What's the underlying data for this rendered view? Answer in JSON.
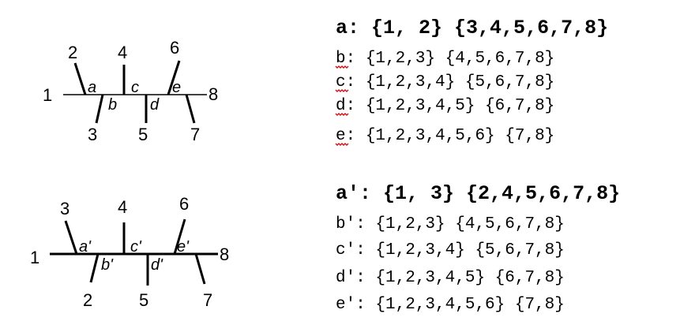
{
  "trees": [
    {
      "leaves": [
        "1",
        "2",
        "3",
        "4",
        "5",
        "6",
        "7",
        "8"
      ],
      "edge_labels": [
        "a",
        "b",
        "c",
        "d",
        "e"
      ],
      "splits": [
        {
          "label": "a:",
          "text": "{1, 2} {3,4,5,6,7,8}"
        },
        {
          "label": "b:",
          "text": "{1,2,3} {4,5,6,7,8}"
        },
        {
          "label": "c:",
          "text": "{1,2,3,4} {5,6,7,8}"
        },
        {
          "label": "d:",
          "text": "{1,2,3,4,5} {6,7,8}"
        },
        {
          "label": "e:",
          "text": "{1,2,3,4,5,6} {7,8}"
        }
      ]
    },
    {
      "leaves": [
        "1",
        "3",
        "2",
        "4",
        "5",
        "6",
        "7",
        "8"
      ],
      "edge_labels": [
        "a'",
        "b'",
        "c'",
        "d'",
        "e'"
      ],
      "splits": [
        {
          "label": "a':",
          "text": "{1, 3} {2,4,5,6,7,8}"
        },
        {
          "label": "b':",
          "text": "{1,2,3} {4,5,6,7,8}"
        },
        {
          "label": "c':",
          "text": "{1,2,3,4} {5,6,7,8}"
        },
        {
          "label": "d':",
          "text": "{1,2,3,4,5} {6,7,8}"
        },
        {
          "label": "e':",
          "text": "{1,2,3,4,5,6} {7,8}"
        }
      ]
    }
  ]
}
